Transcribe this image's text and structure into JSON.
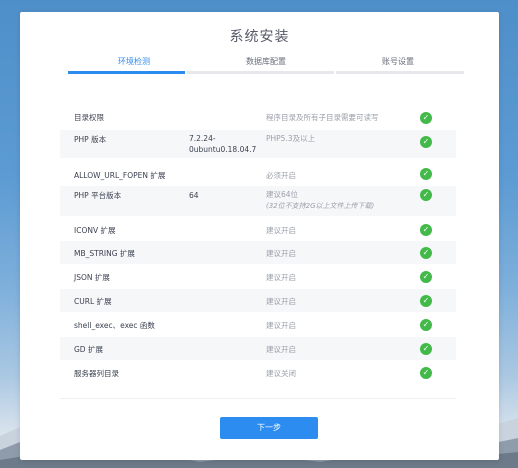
{
  "title": "系统安装",
  "steps": [
    {
      "label": "环境检测",
      "active": true
    },
    {
      "label": "数据库配置",
      "active": false
    },
    {
      "label": "账号设置",
      "active": false
    }
  ],
  "checks": [
    {
      "name": "目录权限",
      "current": "",
      "requirement": "程序目录及所有子目录需要可读写",
      "note": "",
      "status": "ok-icon"
    },
    {
      "name": "PHP 版本",
      "current": "7.2.24-0ubuntu0.18.04.7",
      "requirement": "PHP5.3及以上",
      "note": "",
      "status": "ok-icon"
    },
    {
      "name": "ALLOW_URL_FOPEN 扩展",
      "current": "",
      "requirement": "必须开启",
      "note": "",
      "status": "ok-icon"
    },
    {
      "name": "PHP 平台版本",
      "current": "64",
      "requirement": "建议64位",
      "note": "(32位不支持2G以上文件上传下载)",
      "status": "ok-icon"
    },
    {
      "name": "ICONV 扩展",
      "current": "",
      "requirement": "建议开启",
      "note": "",
      "status": "ok-icon"
    },
    {
      "name": "MB_STRING 扩展",
      "current": "",
      "requirement": "建议开启",
      "note": "",
      "status": "ok-icon"
    },
    {
      "name": "JSON 扩展",
      "current": "",
      "requirement": "建议开启",
      "note": "",
      "status": "ok-icon"
    },
    {
      "name": "CURL 扩展",
      "current": "",
      "requirement": "建议开启",
      "note": "",
      "status": "ok-icon"
    },
    {
      "name": "shell_exec、exec 函数",
      "current": "",
      "requirement": "建议开启",
      "note": "",
      "status": "ok-icon"
    },
    {
      "name": "GD 扩展",
      "current": "",
      "requirement": "建议开启",
      "note": "",
      "status": "ok-icon"
    },
    {
      "name": "服务器列目录",
      "current": "",
      "requirement": "建议关闭",
      "note": "",
      "status": "ok-icon"
    }
  ],
  "next_button": "下一步",
  "colors": {
    "accent": "#2d8cf0",
    "ok": "#43b94a"
  }
}
